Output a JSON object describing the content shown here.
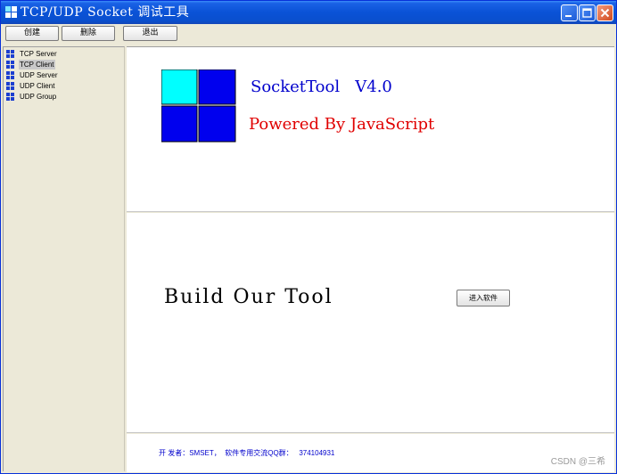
{
  "window": {
    "title": "TCP/UDP Socket 调试工具"
  },
  "toolbar": {
    "create_label": "创建",
    "delete_label": "删除",
    "exit_label": "退出"
  },
  "tree": {
    "items": [
      {
        "label": "TCP Server",
        "selected": false
      },
      {
        "label": "TCP Client",
        "selected": true
      },
      {
        "label": "UDP Server",
        "selected": false
      },
      {
        "label": "UDP Client",
        "selected": false
      },
      {
        "label": "UDP Group",
        "selected": false
      }
    ]
  },
  "logo": {
    "title": "SocketTool   V4.0",
    "subtitle": "Powered By JavaScript"
  },
  "main": {
    "slogan": "Build Our Tool",
    "enter_label": "进入软件"
  },
  "footer": {
    "info": "开 发者：SMSET，  软件专用交流QQ群：   374104931"
  },
  "watermark": "CSDN @三希",
  "colors": {
    "titlebar": "#0a52d6",
    "logo_cyan": "#00ffff",
    "logo_blue": "#0000ee",
    "title_blue": "#0000cc",
    "subtitle_red": "#e00000"
  }
}
